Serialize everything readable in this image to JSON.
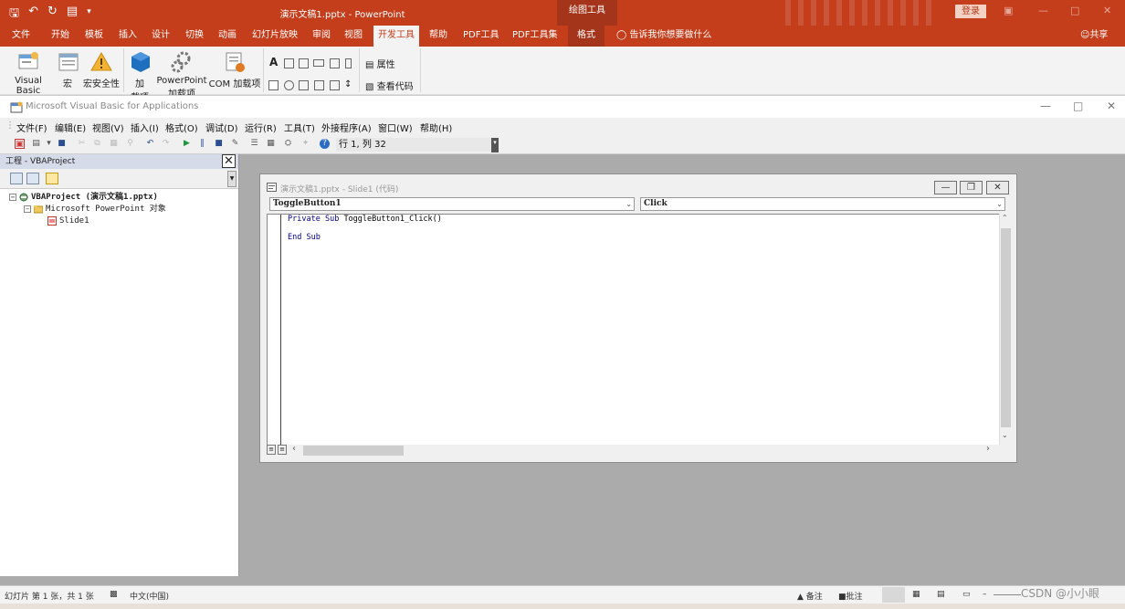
{
  "powerpoint": {
    "doc_title": "演示文稿1.pptx  -  PowerPoint",
    "context_tool_group": "绘图工具",
    "login_button": "登录",
    "tabs": [
      "文件",
      "开始",
      "模板",
      "插入",
      "设计",
      "切换",
      "动画",
      "幻灯片放映",
      "审阅",
      "视图",
      "开发工具",
      "帮助",
      "PDF工具",
      "PDF工具集",
      "格式"
    ],
    "active_tab": "开发工具",
    "tell_me": "告诉我你想要做什么",
    "share": "共享",
    "ribbon": {
      "visual_basic": "Visual Basic",
      "macro": "宏",
      "macro_security": "宏安全性",
      "addins_line1": "加",
      "addins_line2": "载项",
      "ppt_addins_line1": "PowerPoint",
      "ppt_addins_line2": "加载项",
      "com_addins": "COM 加载项",
      "properties": "属性",
      "view_code": "查看代码"
    }
  },
  "vba": {
    "window_title": "Microsoft Visual Basic for Applications",
    "menu": [
      "文件(F)",
      "编辑(E)",
      "视图(V)",
      "插入(I)",
      "格式(O)",
      "调试(D)",
      "运行(R)",
      "工具(T)",
      "外接程序(A)",
      "窗口(W)",
      "帮助(H)"
    ],
    "cursor_position": "行 1, 列 32",
    "project_pane": {
      "title": "工程 - VBAProject",
      "tree": {
        "project": "VBAProject (演示文稿1.pptx)",
        "folder": "Microsoft PowerPoint 对象",
        "slide": "Slide1"
      }
    },
    "code_window": {
      "title": "演示文稿1.pptx - Slide1 (代码)",
      "object_combo": "ToggleButton1",
      "procedure_combo": "Click",
      "lines": {
        "l1_kw1": "Private",
        "l1_kw2": "Sub",
        "l1_name": "ToggleButton1_Click()",
        "l2_kw": "End Sub"
      }
    }
  },
  "status_bar": {
    "slide_info": "幻灯片 第 1 张，共 1 张",
    "language": "中文(中国)",
    "notes": "备注",
    "comments": "批注",
    "zoom_minus": "–"
  },
  "watermark": "CSDN @小小眼"
}
